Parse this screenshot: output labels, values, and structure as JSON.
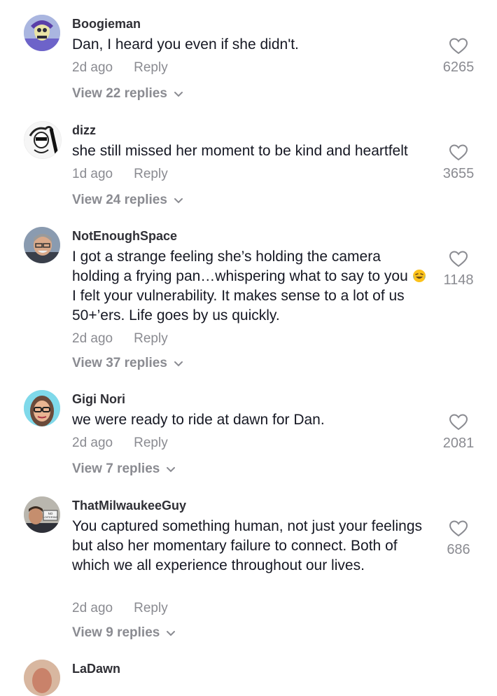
{
  "comments": [
    {
      "username": "Boogieman",
      "text": "Dan, I heard you even if she didn't.",
      "time": "2d ago",
      "reply": "Reply",
      "replies": "View 22 replies",
      "likes": "6265"
    },
    {
      "username": "dizz",
      "text": "she still missed her moment to be kind and heartfelt",
      "time": "1d ago",
      "reply": "Reply",
      "replies": "View 24 replies",
      "likes": "3655"
    },
    {
      "username": "NotEnoughSpace",
      "text": "I got a strange feeling she’s holding the camera holding a frying pan…whispering what to say to you",
      "text_rest": "I felt your vulnerability. It makes sense to a lot of us 50+’ers. Life goes by us quickly.",
      "emoji": "face-with-tears-of-joy",
      "time": "2d ago",
      "reply": "Reply",
      "replies": "View 37 replies",
      "likes": "1148"
    },
    {
      "username": "Gigi Nori",
      "text": "we were ready to ride at dawn for Dan.",
      "time": "2d ago",
      "reply": "Reply",
      "replies": "View 7 replies",
      "likes": "2081"
    },
    {
      "username": "ThatMilwaukeeGuy",
      "text": "You captured something human, not just your feelings but also her momentary failure to connect. Both of which we all experience throughout our lives.",
      "time": "2d ago",
      "reply": "Reply",
      "replies": "View 9 replies",
      "likes": "686",
      "avatar_sign": "NO LOITERING"
    },
    {
      "username": "LaDawn"
    }
  ],
  "icons": {
    "like": "heart-outline-icon",
    "expand": "chevron-down-icon"
  },
  "colors": {
    "text": "#161823",
    "secondary": "#8a8b91"
  }
}
